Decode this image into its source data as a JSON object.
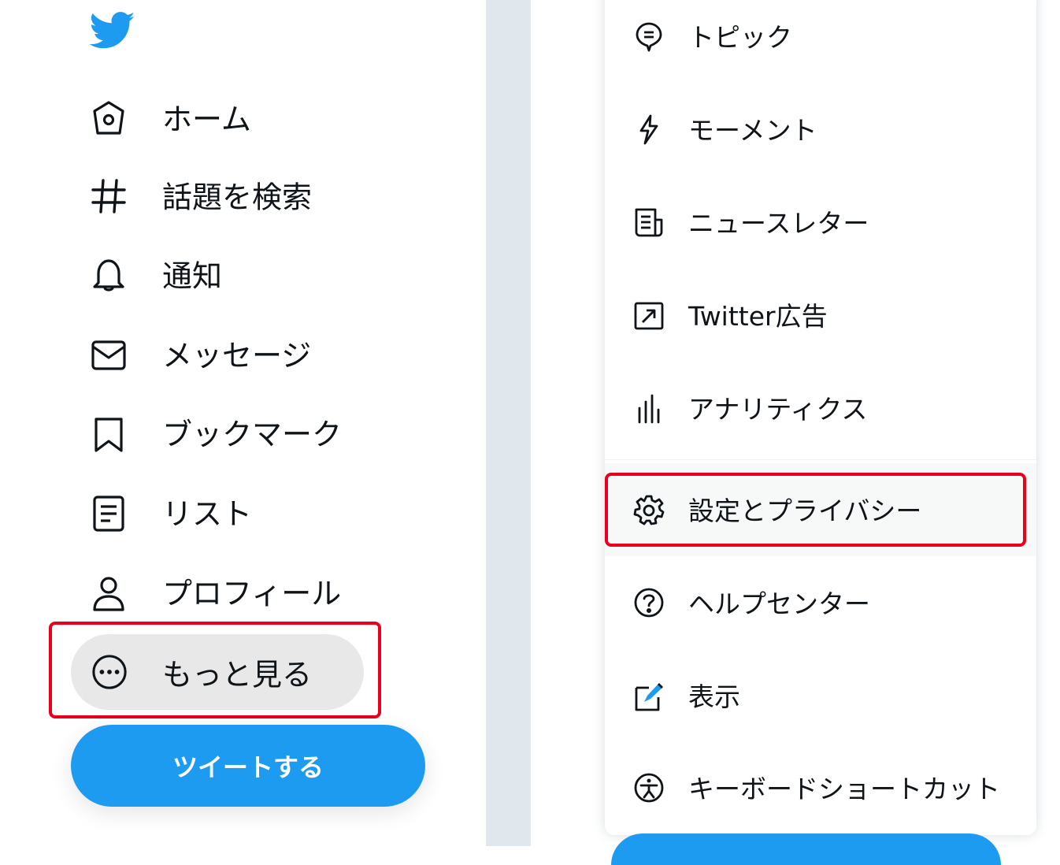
{
  "colors": {
    "accent": "#1d9bf0",
    "highlight": "#e8001c",
    "gutter": "#e1e8ed",
    "pill": "#e8e8e8"
  },
  "logo_icon": "twitter-bird-icon",
  "sidebar": {
    "items": [
      {
        "label": "ホーム",
        "icon": "home-icon"
      },
      {
        "label": "話題を検索",
        "icon": "hashtag-icon"
      },
      {
        "label": "通知",
        "icon": "bell-icon"
      },
      {
        "label": "メッセージ",
        "icon": "envelope-icon"
      },
      {
        "label": "ブックマーク",
        "icon": "bookmark-icon"
      },
      {
        "label": "リスト",
        "icon": "list-icon"
      },
      {
        "label": "プロフィール",
        "icon": "person-icon"
      }
    ],
    "more": {
      "label": "もっと見る",
      "icon": "more-dots-icon"
    },
    "tweet_button": "ツイートする"
  },
  "menu": {
    "items": [
      {
        "label": "トピック",
        "icon": "topic-icon"
      },
      {
        "label": "モーメント",
        "icon": "lightning-icon"
      },
      {
        "label": "ニュースレター",
        "icon": "newsletter-icon"
      },
      {
        "label": "Twitter広告",
        "icon": "external-arrow-icon"
      },
      {
        "label": "アナリティクス",
        "icon": "analytics-bars-icon"
      },
      {
        "label": "設定とプライバシー",
        "icon": "gear-icon"
      },
      {
        "label": "ヘルプセンター",
        "icon": "help-icon"
      },
      {
        "label": "表示",
        "icon": "display-brush-icon"
      },
      {
        "label": "キーボードショートカット",
        "icon": "accessibility-icon"
      }
    ]
  }
}
